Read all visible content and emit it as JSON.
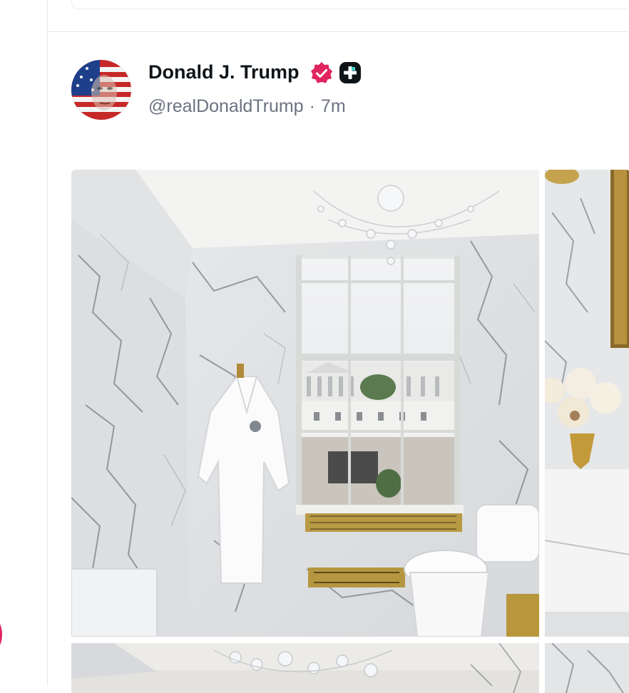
{
  "post": {
    "author": {
      "display_name": "Donald J. Trump",
      "handle": "@realDonaldTrump",
      "verified": true,
      "badges": [
        "verified-icon",
        "plus-badge-icon"
      ]
    },
    "separator": "·",
    "timestamp": "7m",
    "media": [
      {
        "name": "photo-bathroom-window",
        "description_icon": "image"
      },
      {
        "name": "photo-vanity-roses",
        "description_icon": "image"
      },
      {
        "name": "photo-chandelier",
        "description_icon": "image"
      },
      {
        "name": "photo-marble-detail",
        "description_icon": "image"
      }
    ]
  },
  "colors": {
    "name_text": "#0f1419",
    "meta_text": "#6b7280",
    "verified_badge": "#e0245e",
    "divider": "#e6e8eb"
  }
}
